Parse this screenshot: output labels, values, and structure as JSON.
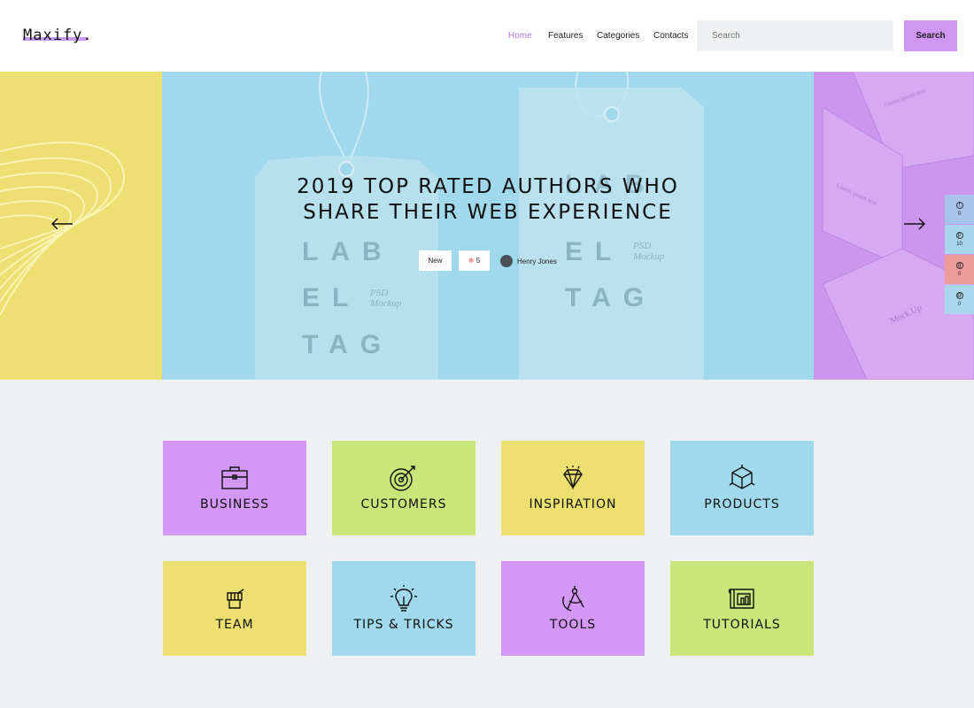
{
  "header": {
    "logo": "Maxify.",
    "nav": [
      {
        "label": "Home",
        "active": true
      },
      {
        "label": "Features",
        "active": false
      },
      {
        "label": "Categories",
        "active": false
      },
      {
        "label": "Contacts",
        "active": false
      }
    ],
    "search": {
      "placeholder": "Search",
      "button_label": "Search"
    }
  },
  "hero": {
    "title_line1": "2019 TOP RATED AUTHORS WHO",
    "title_line2": "SHARE THEIR WEB EXPERIENCE",
    "tag_label": "New",
    "fire_count": "5",
    "author": "Henry Jones",
    "share": [
      {
        "icon": "facebook-icon",
        "count": "0",
        "color": "#a9c4ea"
      },
      {
        "icon": "pinterest-icon",
        "count": "10",
        "color": "#a7d6ec"
      },
      {
        "icon": "google-plus-icon",
        "count": "0",
        "color": "#ee9a99"
      },
      {
        "icon": "email-icon",
        "count": "0",
        "color": "#a9d7ec"
      }
    ]
  },
  "categories": [
    {
      "label": "BUSINESS",
      "icon": "briefcase-icon",
      "color": "#d398f6"
    },
    {
      "label": "CUSTOMERS",
      "icon": "target-icon",
      "color": "#c8e67a"
    },
    {
      "label": "INSPIRATION",
      "icon": "diamond-icon",
      "color": "#ede071"
    },
    {
      "label": "PRODUCTS",
      "icon": "cube-icon",
      "color": "#a0d8ec"
    },
    {
      "label": "TEAM",
      "icon": "fist-icon",
      "color": "#ede071"
    },
    {
      "label": "TIPS & TRICKS",
      "icon": "lightbulb-icon",
      "color": "#a0d8ec"
    },
    {
      "label": "TOOLS",
      "icon": "compass-icon",
      "color": "#d398f6"
    },
    {
      "label": "TUTORIALS",
      "icon": "blueprint-icon",
      "color": "#c8e67a"
    }
  ],
  "colors": {
    "accent": "#cf96f2",
    "hero_yellow": "#eddf72",
    "hero_blue": "#a0d8ec",
    "hero_purple": "#cc95ee"
  }
}
